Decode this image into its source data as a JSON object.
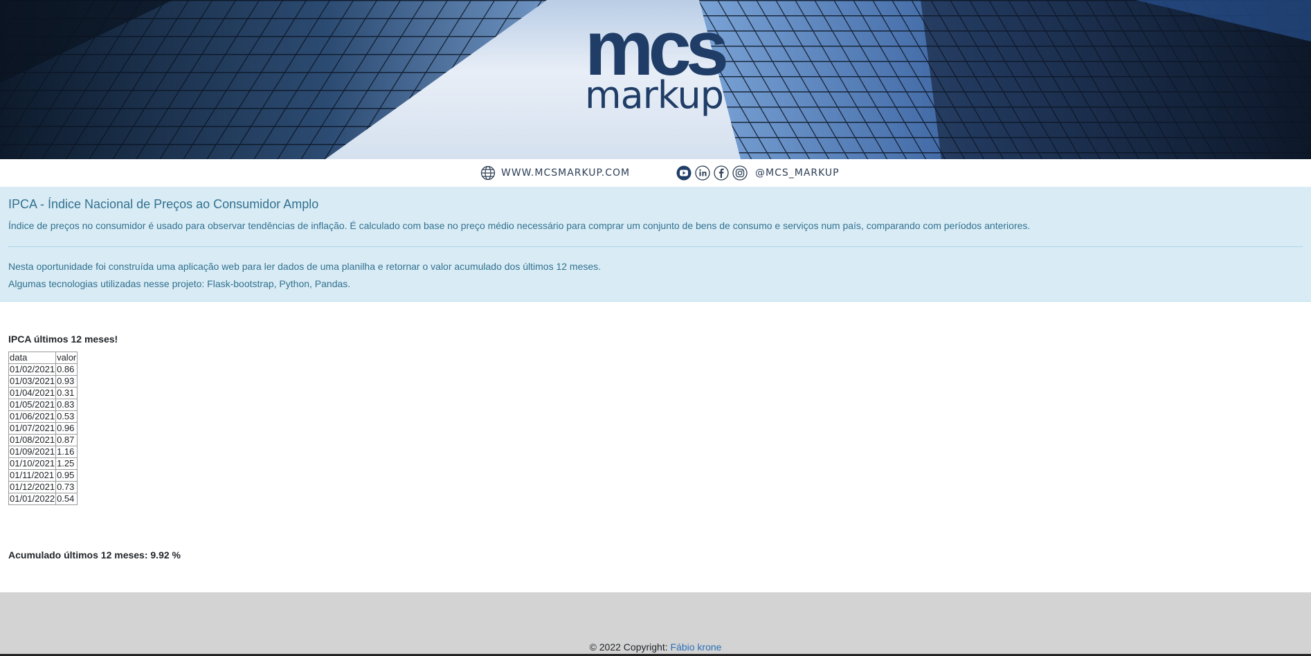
{
  "banner": {
    "logo_top": "mcs",
    "logo_bottom": "markup",
    "website": "WWW.MCSMARKUP.COM",
    "handle": "@MCS_MARKUP",
    "social_icons": [
      "youtube-icon",
      "linkedin-icon",
      "facebook-icon",
      "instagram-icon"
    ]
  },
  "info": {
    "title": "IPCA - Índice Nacional de Preços ao Consumidor Amplo",
    "description": "Índice de preços no consumidor é usado para observar tendências de inflação. É calculado com base no preço médio necessário para comprar um conjunto de bens de consumo e serviços num país, comparando com períodos anteriores.",
    "line1": "Nesta oportunidade foi construída uma aplicação web para ler dados de uma planilha e retornar o valor acumulado dos últimos 12 meses.",
    "line2": "Algumas tecnologias utilizadas nesse projeto: Flask-bootstrap, Python, Pandas."
  },
  "table": {
    "heading": "IPCA últimos 12 meses!",
    "headers": [
      "data",
      "valor"
    ],
    "rows": [
      [
        "01/02/2021",
        "0.86"
      ],
      [
        "01/03/2021",
        "0.93"
      ],
      [
        "01/04/2021",
        "0.31"
      ],
      [
        "01/05/2021",
        "0.83"
      ],
      [
        "01/06/2021",
        "0.53"
      ],
      [
        "01/07/2021",
        "0.96"
      ],
      [
        "01/08/2021",
        "0.87"
      ],
      [
        "01/09/2021",
        "1.16"
      ],
      [
        "01/10/2021",
        "1.25"
      ],
      [
        "01/11/2021",
        "0.95"
      ],
      [
        "01/12/2021",
        "0.73"
      ],
      [
        "01/01/2022",
        "0.54"
      ]
    ]
  },
  "accumulated": "Acumulado últimos 12 meses: 9.92 %",
  "footer": {
    "copyright": "© 2022 Copyright: ",
    "author": "Fábio krone"
  },
  "colors": {
    "info_bg": "#d9ecf5",
    "info_text": "#31708f",
    "footer_bg": "#d3d3d3",
    "link": "#2a6fb8",
    "logo": "#1f3d66"
  }
}
